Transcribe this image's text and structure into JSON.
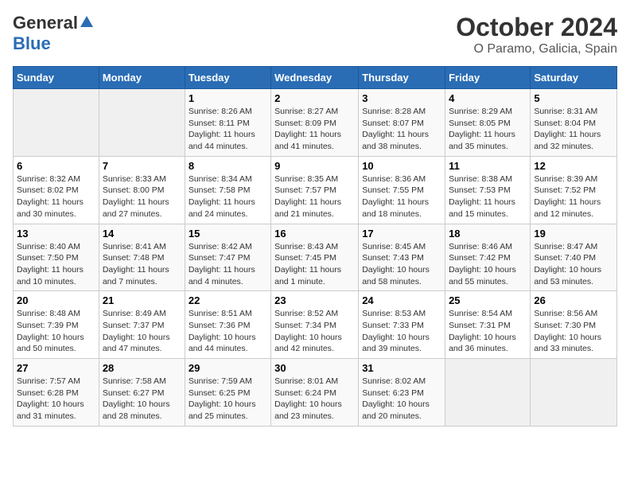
{
  "header": {
    "logo_general": "General",
    "logo_blue": "Blue",
    "title": "October 2024",
    "subtitle": "O Paramo, Galicia, Spain"
  },
  "days_of_week": [
    "Sunday",
    "Monday",
    "Tuesday",
    "Wednesday",
    "Thursday",
    "Friday",
    "Saturday"
  ],
  "weeks": [
    [
      {
        "day": "",
        "sunrise": "",
        "sunset": "",
        "daylight": ""
      },
      {
        "day": "",
        "sunrise": "",
        "sunset": "",
        "daylight": ""
      },
      {
        "day": "1",
        "sunrise": "Sunrise: 8:26 AM",
        "sunset": "Sunset: 8:11 PM",
        "daylight": "Daylight: 11 hours and 44 minutes."
      },
      {
        "day": "2",
        "sunrise": "Sunrise: 8:27 AM",
        "sunset": "Sunset: 8:09 PM",
        "daylight": "Daylight: 11 hours and 41 minutes."
      },
      {
        "day": "3",
        "sunrise": "Sunrise: 8:28 AM",
        "sunset": "Sunset: 8:07 PM",
        "daylight": "Daylight: 11 hours and 38 minutes."
      },
      {
        "day": "4",
        "sunrise": "Sunrise: 8:29 AM",
        "sunset": "Sunset: 8:05 PM",
        "daylight": "Daylight: 11 hours and 35 minutes."
      },
      {
        "day": "5",
        "sunrise": "Sunrise: 8:31 AM",
        "sunset": "Sunset: 8:04 PM",
        "daylight": "Daylight: 11 hours and 32 minutes."
      }
    ],
    [
      {
        "day": "6",
        "sunrise": "Sunrise: 8:32 AM",
        "sunset": "Sunset: 8:02 PM",
        "daylight": "Daylight: 11 hours and 30 minutes."
      },
      {
        "day": "7",
        "sunrise": "Sunrise: 8:33 AM",
        "sunset": "Sunset: 8:00 PM",
        "daylight": "Daylight: 11 hours and 27 minutes."
      },
      {
        "day": "8",
        "sunrise": "Sunrise: 8:34 AM",
        "sunset": "Sunset: 7:58 PM",
        "daylight": "Daylight: 11 hours and 24 minutes."
      },
      {
        "day": "9",
        "sunrise": "Sunrise: 8:35 AM",
        "sunset": "Sunset: 7:57 PM",
        "daylight": "Daylight: 11 hours and 21 minutes."
      },
      {
        "day": "10",
        "sunrise": "Sunrise: 8:36 AM",
        "sunset": "Sunset: 7:55 PM",
        "daylight": "Daylight: 11 hours and 18 minutes."
      },
      {
        "day": "11",
        "sunrise": "Sunrise: 8:38 AM",
        "sunset": "Sunset: 7:53 PM",
        "daylight": "Daylight: 11 hours and 15 minutes."
      },
      {
        "day": "12",
        "sunrise": "Sunrise: 8:39 AM",
        "sunset": "Sunset: 7:52 PM",
        "daylight": "Daylight: 11 hours and 12 minutes."
      }
    ],
    [
      {
        "day": "13",
        "sunrise": "Sunrise: 8:40 AM",
        "sunset": "Sunset: 7:50 PM",
        "daylight": "Daylight: 11 hours and 10 minutes."
      },
      {
        "day": "14",
        "sunrise": "Sunrise: 8:41 AM",
        "sunset": "Sunset: 7:48 PM",
        "daylight": "Daylight: 11 hours and 7 minutes."
      },
      {
        "day": "15",
        "sunrise": "Sunrise: 8:42 AM",
        "sunset": "Sunset: 7:47 PM",
        "daylight": "Daylight: 11 hours and 4 minutes."
      },
      {
        "day": "16",
        "sunrise": "Sunrise: 8:43 AM",
        "sunset": "Sunset: 7:45 PM",
        "daylight": "Daylight: 11 hours and 1 minute."
      },
      {
        "day": "17",
        "sunrise": "Sunrise: 8:45 AM",
        "sunset": "Sunset: 7:43 PM",
        "daylight": "Daylight: 10 hours and 58 minutes."
      },
      {
        "day": "18",
        "sunrise": "Sunrise: 8:46 AM",
        "sunset": "Sunset: 7:42 PM",
        "daylight": "Daylight: 10 hours and 55 minutes."
      },
      {
        "day": "19",
        "sunrise": "Sunrise: 8:47 AM",
        "sunset": "Sunset: 7:40 PM",
        "daylight": "Daylight: 10 hours and 53 minutes."
      }
    ],
    [
      {
        "day": "20",
        "sunrise": "Sunrise: 8:48 AM",
        "sunset": "Sunset: 7:39 PM",
        "daylight": "Daylight: 10 hours and 50 minutes."
      },
      {
        "day": "21",
        "sunrise": "Sunrise: 8:49 AM",
        "sunset": "Sunset: 7:37 PM",
        "daylight": "Daylight: 10 hours and 47 minutes."
      },
      {
        "day": "22",
        "sunrise": "Sunrise: 8:51 AM",
        "sunset": "Sunset: 7:36 PM",
        "daylight": "Daylight: 10 hours and 44 minutes."
      },
      {
        "day": "23",
        "sunrise": "Sunrise: 8:52 AM",
        "sunset": "Sunset: 7:34 PM",
        "daylight": "Daylight: 10 hours and 42 minutes."
      },
      {
        "day": "24",
        "sunrise": "Sunrise: 8:53 AM",
        "sunset": "Sunset: 7:33 PM",
        "daylight": "Daylight: 10 hours and 39 minutes."
      },
      {
        "day": "25",
        "sunrise": "Sunrise: 8:54 AM",
        "sunset": "Sunset: 7:31 PM",
        "daylight": "Daylight: 10 hours and 36 minutes."
      },
      {
        "day": "26",
        "sunrise": "Sunrise: 8:56 AM",
        "sunset": "Sunset: 7:30 PM",
        "daylight": "Daylight: 10 hours and 33 minutes."
      }
    ],
    [
      {
        "day": "27",
        "sunrise": "Sunrise: 7:57 AM",
        "sunset": "Sunset: 6:28 PM",
        "daylight": "Daylight: 10 hours and 31 minutes."
      },
      {
        "day": "28",
        "sunrise": "Sunrise: 7:58 AM",
        "sunset": "Sunset: 6:27 PM",
        "daylight": "Daylight: 10 hours and 28 minutes."
      },
      {
        "day": "29",
        "sunrise": "Sunrise: 7:59 AM",
        "sunset": "Sunset: 6:25 PM",
        "daylight": "Daylight: 10 hours and 25 minutes."
      },
      {
        "day": "30",
        "sunrise": "Sunrise: 8:01 AM",
        "sunset": "Sunset: 6:24 PM",
        "daylight": "Daylight: 10 hours and 23 minutes."
      },
      {
        "day": "31",
        "sunrise": "Sunrise: 8:02 AM",
        "sunset": "Sunset: 6:23 PM",
        "daylight": "Daylight: 10 hours and 20 minutes."
      },
      {
        "day": "",
        "sunrise": "",
        "sunset": "",
        "daylight": ""
      },
      {
        "day": "",
        "sunrise": "",
        "sunset": "",
        "daylight": ""
      }
    ]
  ]
}
